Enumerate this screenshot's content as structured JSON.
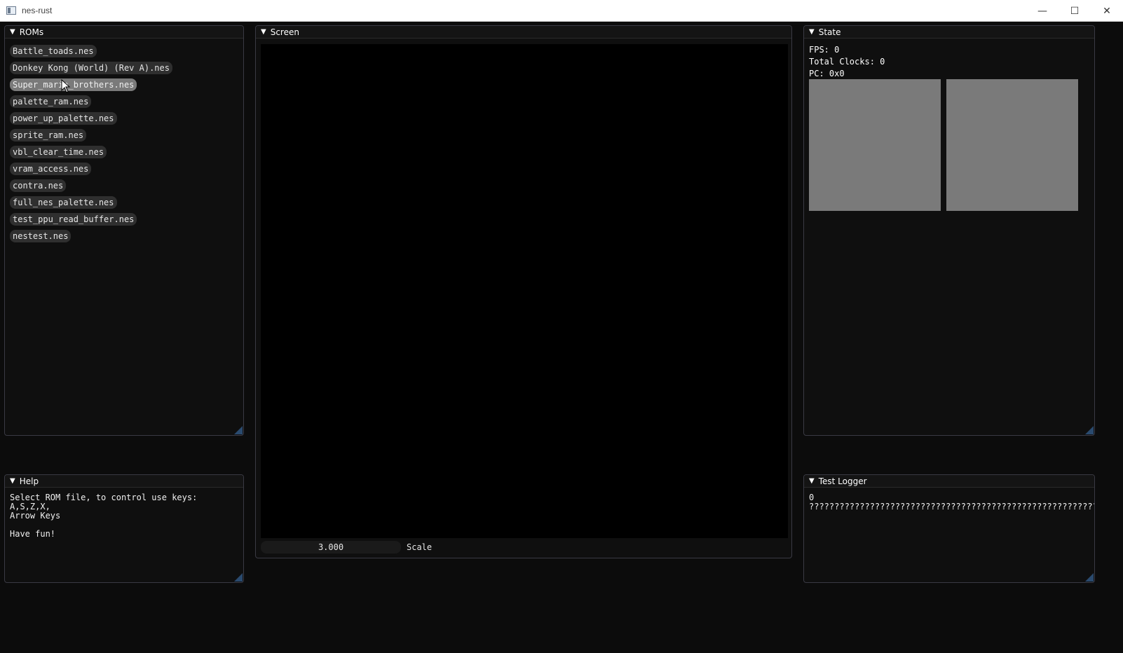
{
  "window": {
    "title": "nes-rust",
    "controls": {
      "minimize": "—",
      "maximize": "☐",
      "close": "✕"
    }
  },
  "roms_panel": {
    "title": "ROMs",
    "items": [
      "Battle_toads.nes",
      "Donkey Kong (World) (Rev A).nes",
      "Super_mario_brothers.nes",
      "palette_ram.nes",
      "power_up_palette.nes",
      "sprite_ram.nes",
      "vbl_clear_time.nes",
      "vram_access.nes",
      "contra.nes",
      "full_nes_palette.nes",
      "test_ppu_read_buffer.nes",
      "nestest.nes"
    ],
    "hovered_index": 2
  },
  "screen_panel": {
    "title": "Screen",
    "scale_value": "3.000",
    "scale_label": "Scale"
  },
  "state_panel": {
    "title": "State",
    "fps": "FPS: 0",
    "total_clocks": "Total Clocks: 0",
    "pc": "PC: 0x0"
  },
  "help_panel": {
    "title": "Help",
    "text": "Select ROM file, to control use keys:\nA,S,Z,X,\nArrow Keys\n\nHave fun!"
  },
  "logger_panel": {
    "title": "Test Logger",
    "text": "0\n??????????????????????????????????????????????????????????????"
  },
  "colors": {
    "background": "#0c0c0c",
    "panel_bg": "#0f0f0f",
    "button": "#2f2f2f",
    "button_hover": "#7a7a7a",
    "resize_grip": "#2a4a6e",
    "pattern_table": "#7a7a7a"
  }
}
